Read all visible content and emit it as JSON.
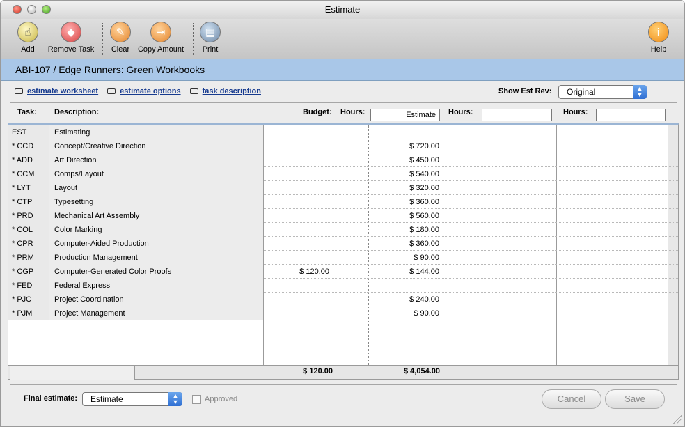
{
  "window": {
    "title": "Estimate"
  },
  "toolbar": {
    "add": "Add",
    "remove": "Remove Task",
    "clear": "Clear",
    "copy": "Copy Amount",
    "print": "Print",
    "help": "Help"
  },
  "banner": {
    "title": "ABI-107 / Edge Runners:  Green Workbooks"
  },
  "links": {
    "worksheet": "estimate worksheet",
    "options": "estimate options",
    "description": "task description"
  },
  "revision": {
    "label": "Show Est Rev:",
    "value": "Original"
  },
  "columns": {
    "task": "Task:",
    "description": "Description:",
    "budget": "Budget:",
    "hours1": "Hours:",
    "estimate_field": "Estimate",
    "hours2": "Hours:",
    "hours3": "Hours:"
  },
  "rows": [
    {
      "task": "EST",
      "description": "Estimating",
      "budget": "",
      "estimate": ""
    },
    {
      "task": "* CCD",
      "description": "Concept/Creative Direction",
      "budget": "",
      "estimate": "$ 720.00"
    },
    {
      "task": "* ADD",
      "description": "Art Direction",
      "budget": "",
      "estimate": "$ 450.00"
    },
    {
      "task": "* CCM",
      "description": "Comps/Layout",
      "budget": "",
      "estimate": "$ 540.00"
    },
    {
      "task": "* LYT",
      "description": "Layout",
      "budget": "",
      "estimate": "$ 320.00"
    },
    {
      "task": "* CTP",
      "description": "Typesetting",
      "budget": "",
      "estimate": "$ 360.00"
    },
    {
      "task": "* PRD",
      "description": "Mechanical Art Assembly",
      "budget": "",
      "estimate": "$ 560.00"
    },
    {
      "task": "* COL",
      "description": "Color Marking",
      "budget": "",
      "estimate": "$ 180.00"
    },
    {
      "task": "* CPR",
      "description": "Computer-Aided Production",
      "budget": "",
      "estimate": "$ 360.00"
    },
    {
      "task": "* PRM",
      "description": "Production Management",
      "budget": "",
      "estimate": "$ 90.00"
    },
    {
      "task": "* CGP",
      "description": "Computer-Generated Color Proofs",
      "budget": "$ 120.00",
      "estimate": "$ 144.00"
    },
    {
      "task": "* FED",
      "description": "Federal Express",
      "budget": "",
      "estimate": ""
    },
    {
      "task": "* PJC",
      "description": "Project Coordination",
      "budget": "",
      "estimate": "$ 240.00"
    },
    {
      "task": "* PJM",
      "description": "Project Management",
      "budget": "",
      "estimate": "$ 90.00"
    }
  ],
  "totals": {
    "budget": "$ 120.00",
    "estimate": "$ 4,054.00"
  },
  "footer": {
    "final_label": "Final estimate:",
    "final_value": "Estimate",
    "approved": "Approved",
    "cancel": "Cancel",
    "save": "Save"
  }
}
